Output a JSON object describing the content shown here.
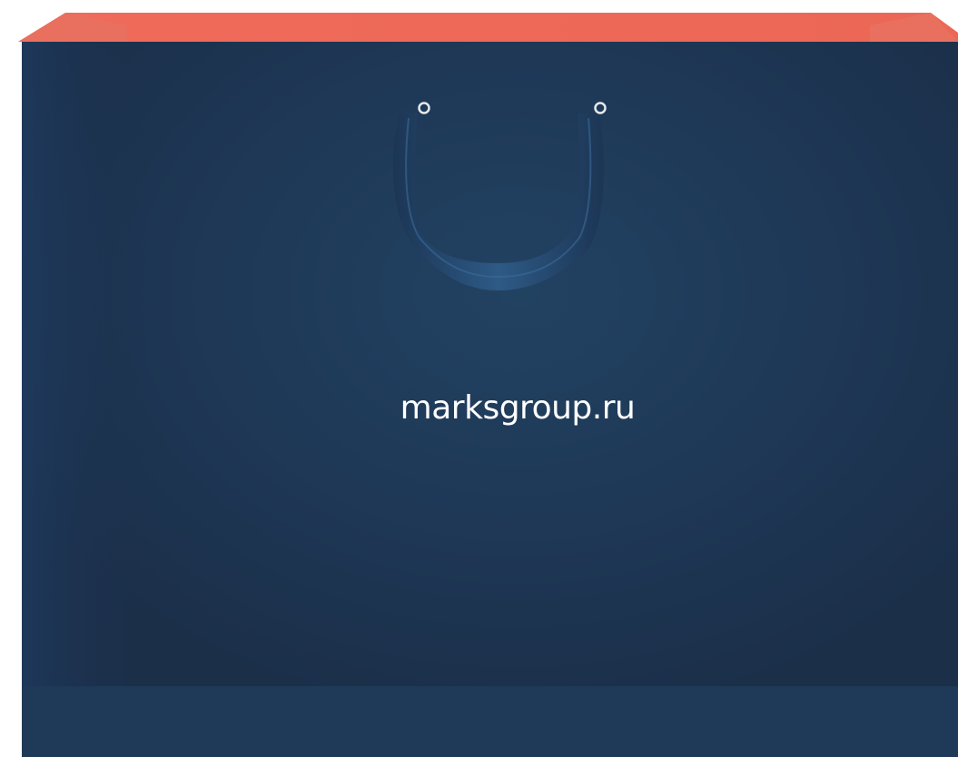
{
  "bag": {
    "text": "marksgroup.ru",
    "body_color": "#1B2F49",
    "body_center_color": "#21405F",
    "bottom_band_color": "#1E3A58",
    "inner_lining_color": "#EE6A59",
    "inner_flap_color": "#1A2B42",
    "handle_color": "#2E5A86",
    "grommet_color": "#E6E8EA"
  }
}
